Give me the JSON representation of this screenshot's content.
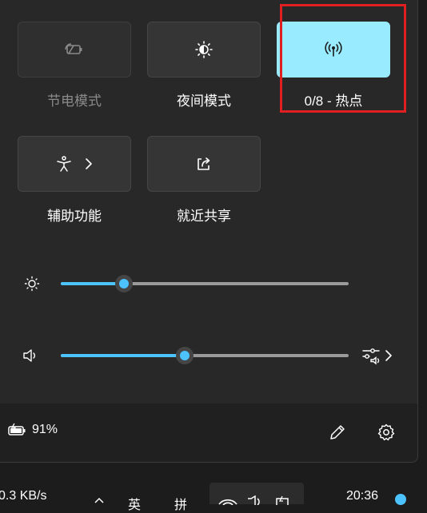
{
  "tiles": {
    "battery_saver": {
      "label": "节电模式",
      "icon": "battery-saver-icon",
      "state": "disabled"
    },
    "night_light": {
      "label": "夜间模式",
      "icon": "night-light-icon",
      "state": "off"
    },
    "hotspot": {
      "label": "0/8 - 热点",
      "icon": "hotspot-icon",
      "state": "on"
    },
    "accessibility": {
      "label": "辅助功能",
      "icon": "accessibility-icon",
      "chevron": "chevron-right-icon"
    },
    "nearby_share": {
      "label": "就近共享",
      "icon": "share-icon"
    }
  },
  "sliders": {
    "brightness": {
      "icon": "brightness-icon",
      "value_percent": 22
    },
    "volume": {
      "icon": "volume-icon",
      "value_percent": 43,
      "extra_icon": "audio-output-icon"
    }
  },
  "footer": {
    "battery_text": "91%",
    "battery_icon": "battery-charging-icon",
    "edit_icon": "pencil-icon",
    "settings_icon": "gear-icon"
  },
  "taskbar": {
    "net_speed": "0.3 KB/s",
    "ime_1": "英",
    "ime_2": "拼",
    "clock": "20:36"
  },
  "colors": {
    "accent": "#4cc2ff",
    "active_tile": "#99ebff",
    "highlight_box": "#e02020"
  }
}
